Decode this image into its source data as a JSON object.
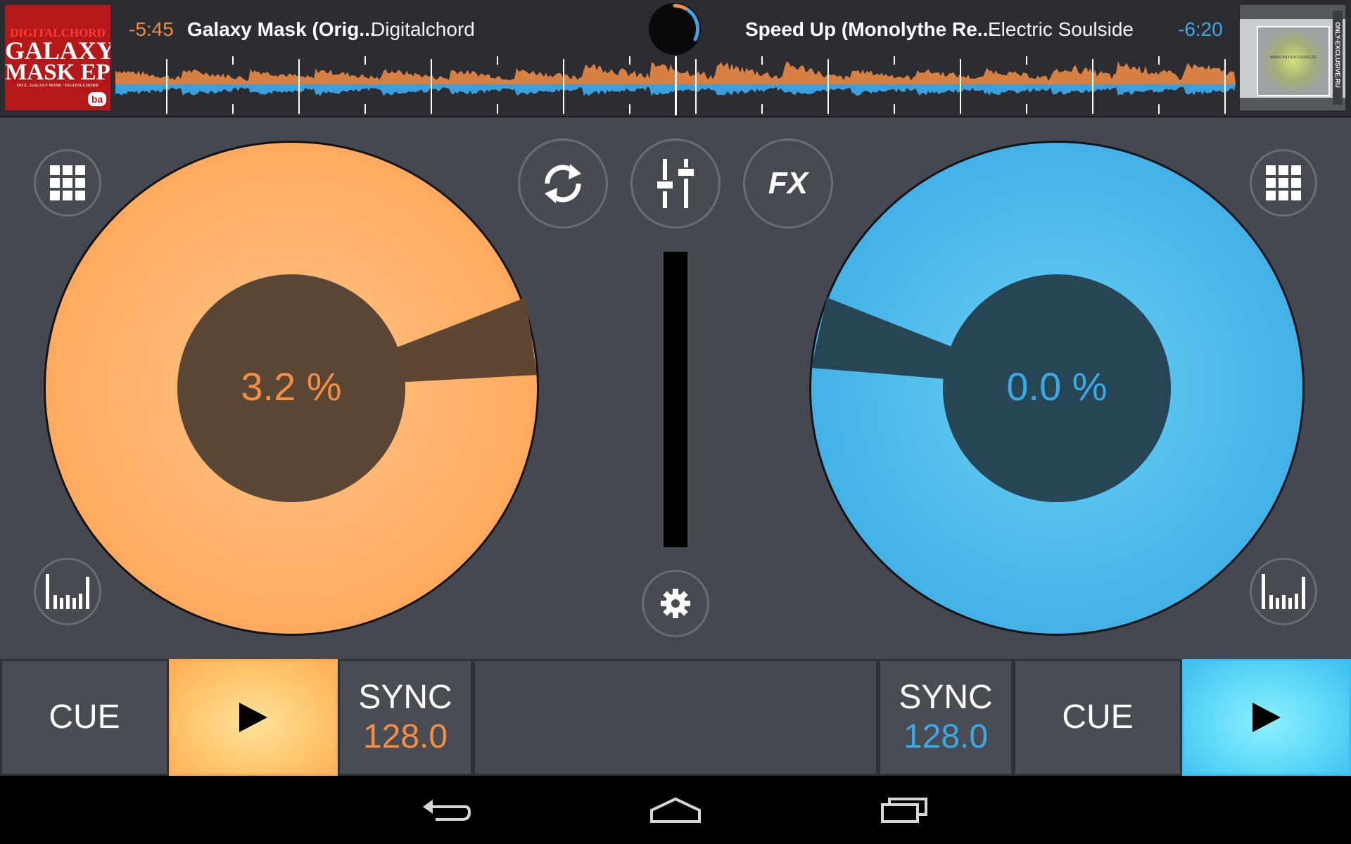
{
  "deck_left": {
    "time_remaining": "-5:45",
    "title": "Galaxy Mask (Orig...",
    "artist": "Digitalchord",
    "pitch": "3.2 %",
    "cue_label": "CUE",
    "sync_label": "SYNC",
    "bpm": "128.0",
    "accent_color": "#f58d42",
    "cover": {
      "line1": "DIGITALCHORD",
      "line2": "GALAXY",
      "line3": "MASK EP",
      "line4": "INCL. GALAXY MASK / DIGITALCHORD",
      "logo": "ba"
    }
  },
  "deck_right": {
    "time_remaining": "-6:20",
    "title": "Speed Up (Monolythe Re...",
    "artist": "Electric Soulside",
    "pitch": "0.0 %",
    "cue_label": "CUE",
    "sync_label": "SYNC",
    "bpm": "128.0",
    "accent_color": "#3ba9e6",
    "cover": {
      "side_text": "ONLY-EXCLUSIVE.RU",
      "center_text": "WWW.ONLY-EXCLUSIVE.RU"
    }
  },
  "center": {
    "fx_label": "FX"
  },
  "icons": {
    "loop": "loop-icon",
    "mixer": "mixer-sliders-icon",
    "settings": "gear-icon",
    "grid": "pad-grid-icon",
    "eq": "eq-bars-icon",
    "play": "play-icon",
    "back": "back-arrow-icon",
    "home": "home-icon",
    "recent": "recent-apps-icon"
  }
}
